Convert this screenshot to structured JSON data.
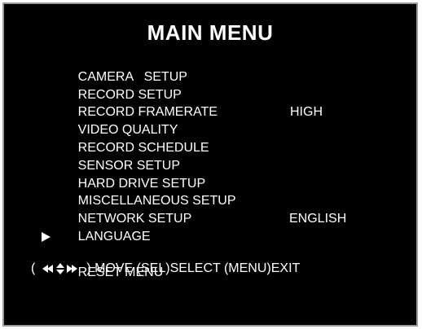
{
  "title": "MAIN MENU",
  "menu": {
    "items": [
      {
        "label": "CAMERA   SETUP",
        "value": ""
      },
      {
        "label": "RECORD SETUP",
        "value": ""
      },
      {
        "label": "RECORD FRAMERATE",
        "value": ""
      },
      {
        "label": "VIDEO QUALITY",
        "value": "HIGH"
      },
      {
        "label": "RECORD SCHEDULE",
        "value": ""
      },
      {
        "label": "SENSOR SETUP",
        "value": ""
      },
      {
        "label": "HARD DRIVE SETUP",
        "value": ""
      },
      {
        "label": "MISCELLANEOUS SETUP",
        "value": ""
      },
      {
        "label": "NETWORK SETUP",
        "value": ""
      },
      {
        "label": "LANGUAGE",
        "value": "ENGLISH"
      },
      {
        "label": "RESET MENU",
        "value": "",
        "selected": true
      }
    ]
  },
  "hint": {
    "open": "(",
    "move_label": ") MOVE (SEL)SELECT (MENU)EXIT"
  },
  "icons": {
    "cursor": "right-triangle-icon",
    "nav": "direction-arrows-icon"
  },
  "colors": {
    "background": "#000000",
    "text": "#ffffff",
    "frame": "#9a9a9a"
  }
}
